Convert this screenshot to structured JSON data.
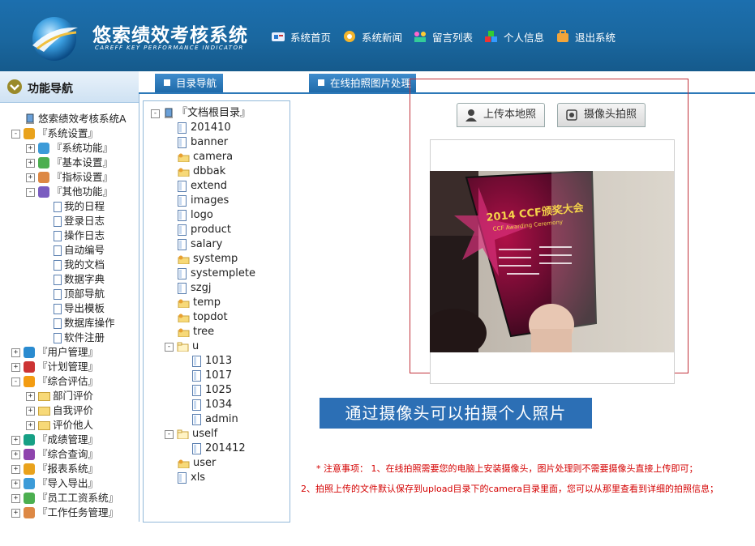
{
  "header": {
    "title": "悠索绩效考核系统",
    "subtitle": "CAREFF KEY PERFORMANCE INDICATOR",
    "nav": [
      {
        "label": "系统首页",
        "icon": "home-icon"
      },
      {
        "label": "系统新闻",
        "icon": "news-icon"
      },
      {
        "label": "留言列表",
        "icon": "message-icon"
      },
      {
        "label": "个人信息",
        "icon": "user-info-icon"
      },
      {
        "label": "退出系统",
        "icon": "logout-icon"
      }
    ]
  },
  "sidebar": {
    "title": "功能导航",
    "root": "悠索绩效考核系统A",
    "items": [
      {
        "label": "『系统设置』",
        "level": 0,
        "toggle": "-"
      },
      {
        "label": "『系统功能』",
        "level": 1,
        "toggle": "+"
      },
      {
        "label": "『基本设置』",
        "level": 1,
        "toggle": "+"
      },
      {
        "label": "『指标设置』",
        "level": 1,
        "toggle": "+"
      },
      {
        "label": "『其他功能』",
        "level": 1,
        "toggle": "-"
      },
      {
        "label": "我的日程",
        "level": 2
      },
      {
        "label": "登录日志",
        "level": 2
      },
      {
        "label": "操作日志",
        "level": 2
      },
      {
        "label": "自动编号",
        "level": 2
      },
      {
        "label": "我的文档",
        "level": 2
      },
      {
        "label": "数据字典",
        "level": 2
      },
      {
        "label": "顶部导航",
        "level": 2
      },
      {
        "label": "导出模板",
        "level": 2
      },
      {
        "label": "数据库操作",
        "level": 2
      },
      {
        "label": "软件注册",
        "level": 2
      },
      {
        "label": "『用户管理』",
        "level": 0,
        "toggle": "+"
      },
      {
        "label": "『计划管理』",
        "level": 0,
        "toggle": "+"
      },
      {
        "label": "『综合评估』",
        "level": 0,
        "toggle": "-"
      },
      {
        "label": "部门评价",
        "level": 1,
        "toggle": "+",
        "folder": true
      },
      {
        "label": "自我评价",
        "level": 1,
        "toggle": "+",
        "folder": true
      },
      {
        "label": "评价他人",
        "level": 1,
        "toggle": "+",
        "folder": true
      },
      {
        "label": "『成绩管理』",
        "level": 0,
        "toggle": "+"
      },
      {
        "label": "『综合查询』",
        "level": 0,
        "toggle": "+"
      },
      {
        "label": "『报表系统』",
        "level": 0,
        "toggle": "+"
      },
      {
        "label": "『导入导出』",
        "level": 0,
        "toggle": "+"
      },
      {
        "label": "『员工工资系统』",
        "level": 0,
        "toggle": "+"
      },
      {
        "label": "『工作任务管理』",
        "level": 0,
        "toggle": "+"
      }
    ]
  },
  "tabs": [
    {
      "label": "目录导航"
    },
    {
      "label": "在线拍照图片处理"
    }
  ],
  "doc_tree": {
    "root": "『文档根目录』",
    "items": [
      {
        "label": "201410",
        "type": "doc",
        "level": 1
      },
      {
        "label": "banner",
        "type": "doc",
        "level": 1
      },
      {
        "label": "camera",
        "type": "folder-key",
        "level": 1
      },
      {
        "label": "dbbak",
        "type": "folder-key",
        "level": 1
      },
      {
        "label": "extend",
        "type": "doc",
        "level": 1
      },
      {
        "label": "images",
        "type": "doc",
        "level": 1
      },
      {
        "label": "logo",
        "type": "doc",
        "level": 1
      },
      {
        "label": "product",
        "type": "doc",
        "level": 1
      },
      {
        "label": "salary",
        "type": "doc",
        "level": 1
      },
      {
        "label": "systemp",
        "type": "folder-key",
        "level": 1
      },
      {
        "label": "systemplete",
        "type": "doc",
        "level": 1
      },
      {
        "label": "szgj",
        "type": "doc",
        "level": 1
      },
      {
        "label": "temp",
        "type": "folder-key",
        "level": 1
      },
      {
        "label": "topdot",
        "type": "folder-key",
        "level": 1
      },
      {
        "label": "tree",
        "type": "folder-key",
        "level": 1
      },
      {
        "label": "u",
        "type": "folder-open",
        "level": 1,
        "toggle": "-"
      },
      {
        "label": "1013",
        "type": "doc",
        "level": 2
      },
      {
        "label": "1017",
        "type": "doc",
        "level": 2
      },
      {
        "label": "1025",
        "type": "doc",
        "level": 2
      },
      {
        "label": "1034",
        "type": "doc",
        "level": 2
      },
      {
        "label": "admin",
        "type": "doc",
        "level": 2
      },
      {
        "label": "uself",
        "type": "folder-open",
        "level": 1,
        "toggle": "-"
      },
      {
        "label": "201412",
        "type": "doc",
        "level": 2
      },
      {
        "label": "user",
        "type": "folder-key",
        "level": 1
      },
      {
        "label": "xls",
        "type": "doc",
        "level": 1
      }
    ]
  },
  "upload": {
    "local_button": "上传本地照",
    "camera_button": "摄像头拍照",
    "caption": "通过摄像头可以拍摄个人照片",
    "photo": {
      "poster_title": "2014 CCF颁奖大会",
      "poster_subtitle": "CCF Awarding Ceremony"
    }
  },
  "notes": {
    "line1": "* 注意事项：  1、在线拍照需要您的电脑上安装摄像头，图片处理则不需要摄像头直接上传即可；",
    "line2": "2、拍照上传的文件默认保存到upload目录下的camera目录里面，您可以从那里查看到详细的拍照信息；"
  },
  "colors": {
    "header": "#1a679f",
    "tab": "#2d79b8",
    "highlight": "#c2323c",
    "caption": "#2c6fb5",
    "note": "#d40000"
  }
}
